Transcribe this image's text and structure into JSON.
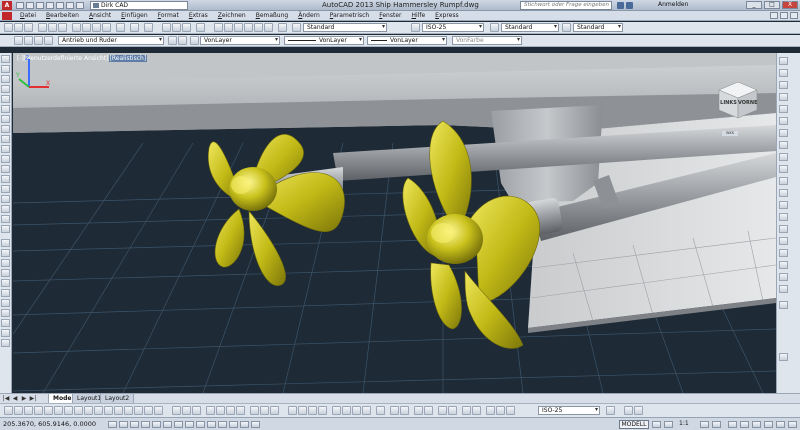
{
  "app": {
    "workspace": "Dirk CAD",
    "title": "AutoCAD 2013   Ship Hammersley Rumpf.dwg",
    "search_placeholder": "Stichwort oder Frage eingeben",
    "login_label": "Anmelden",
    "window_buttons": [
      "_",
      "□",
      "X"
    ]
  },
  "menu": {
    "items": [
      "Datei",
      "Bearbeiten",
      "Ansicht",
      "Einfügen",
      "Format",
      "Extras",
      "Zeichnen",
      "Bemaßung",
      "Ändern",
      "Parametrisch",
      "Fenster",
      "Hilfe",
      "Express"
    ]
  },
  "toolbar1": {
    "text_style": "Standard",
    "dim_style": "ISO-25",
    "table_style": "Standard",
    "mleader_style": "Standard"
  },
  "toolbar2": {
    "layer": "Antrieb und Ruder",
    "color": "VonLayer",
    "linetype": "VonLayer",
    "lineweight": "VonLayer",
    "plotstyle": "VonFarbe"
  },
  "viewport": {
    "label_prefix": "[-][Benutzerdefinierte Ansicht]",
    "label_style": "[Realistisch]",
    "viewcube_left": "LINKS",
    "viewcube_front": "VORNE",
    "wcs_tag": "WKS"
  },
  "tabs": {
    "nav": [
      "|◀",
      "◀",
      "▶",
      "▶|"
    ],
    "items": [
      "Modell",
      "Layout1",
      "Layout2"
    ],
    "active_index": 0
  },
  "bottom_toolbar": {
    "dim_style": "ISO-25"
  },
  "status": {
    "coordinates": "205.3670, 605.9146, 0.0000",
    "space": "MODELL",
    "scale": "1:1"
  },
  "colors": {
    "viewport_bg": "#1e2a36",
    "propeller": "#c8c41a",
    "hull": "#a8acb0",
    "grid": "#3c5468"
  }
}
